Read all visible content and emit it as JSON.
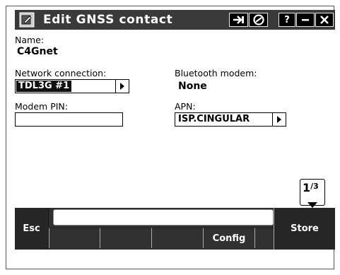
{
  "window": {
    "title": "Edit GNSS contact",
    "buttons": {
      "help": "?"
    }
  },
  "fields": {
    "name": {
      "label": "Name:",
      "value": "C4Gnet"
    },
    "network_connection": {
      "label": "Network connection:",
      "value": "TDL3G #1"
    },
    "bluetooth_modem": {
      "label": "Bluetooth modem:",
      "value": "None"
    },
    "modem_pin": {
      "label": "Modem PIN:",
      "value": "",
      "placeholder": ""
    },
    "apn": {
      "label": "APN:",
      "value": "ISP.CINGULAR"
    }
  },
  "pager": {
    "current": "1",
    "total": "3"
  },
  "softkeys": {
    "esc": "Esc",
    "store": "Store",
    "function_keys": [
      "",
      "",
      "",
      "Config",
      ""
    ]
  },
  "colors": {
    "title_bar": "#3a3a3a",
    "softkey_bar": "#2f2f2f",
    "selection": "#111111"
  },
  "icons": {
    "app": "edit-contact-icon",
    "transfer": "arrow-transfer-icon",
    "status": "circle-check-icon",
    "minimize": "minimize-icon",
    "close": "close-icon",
    "dropdown": "triangle-right-icon",
    "page_down": "triangle-down-icon"
  }
}
